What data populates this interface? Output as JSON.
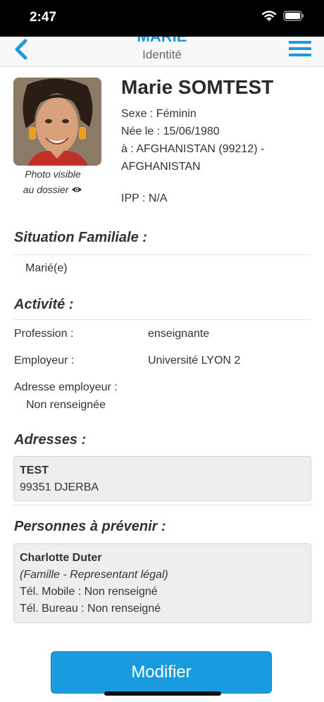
{
  "status_bar": {
    "time": "2:47"
  },
  "header": {
    "title": "MARIE",
    "subtitle": "Identité"
  },
  "patient": {
    "name": "Marie SOMTEST",
    "sex": "Sexe : Féminin",
    "birth_date": "Née le : 15/06/1980",
    "birth_place_line1": "à : AFGHANISTAN (99212) -",
    "birth_place_line2": "AFGHANISTAN",
    "ipp": "IPP : N/A",
    "photo_caption_line1": "Photo visible",
    "photo_caption_line2": "au dossier"
  },
  "family": {
    "title": "Situation Familiale :",
    "status": "Marié(e)"
  },
  "activity": {
    "title": "Activité :",
    "profession_label": "Profession :",
    "profession_value": "enseignante",
    "employer_label": "Employeur :",
    "employer_value": "Université LYON 2",
    "employer_address_label": "Adresse employeur :",
    "employer_address_value": "Non renseignée"
  },
  "addresses": {
    "title": "Adresses :",
    "items": [
      {
        "name": "TEST",
        "city": "99351 DJERBA"
      }
    ]
  },
  "contacts": {
    "title": "Personnes à prévenir :",
    "items": [
      {
        "name": "Charlotte Duter",
        "relation": "(Famille - Representant légal)",
        "mobile": "Tél. Mobile : Non renseigné",
        "office": "Tél. Bureau : Non renseigné"
      }
    ]
  },
  "actions": {
    "modify_label": "Modifier"
  },
  "colors": {
    "accent": "#1a9be0",
    "card_bg": "#eeeeee"
  }
}
